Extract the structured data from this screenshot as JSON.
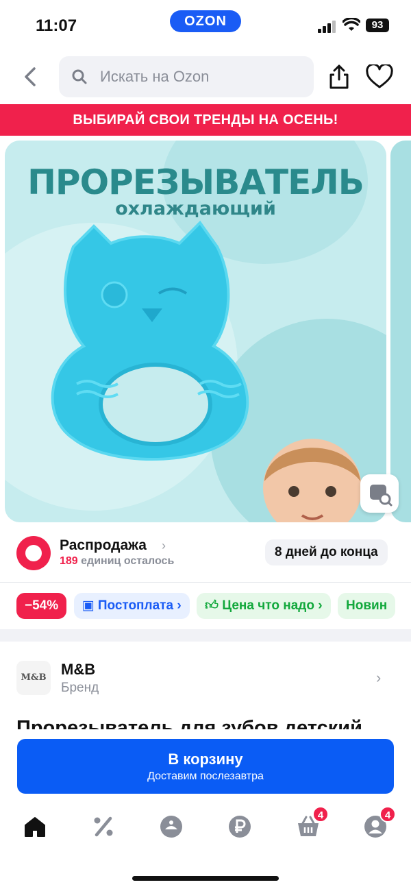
{
  "status_bar": {
    "time": "11:07",
    "carrier_logo": "OZON",
    "battery": "93"
  },
  "header": {
    "search_placeholder": "Искать на Ozon"
  },
  "promo_banner": {
    "text": "ВЫБИРАЙ СВОИ ТРЕНДЫ НА ОСЕНЬ!"
  },
  "product_image": {
    "title": "ПРОРЕЗЫВАТЕЛЬ",
    "subtitle": "охлаждающий"
  },
  "sale": {
    "title": "Распродажа",
    "count": "189",
    "count_suffix": "единиц осталось",
    "days_left": "8 дней до конца"
  },
  "chips": {
    "discount": "−54%",
    "postpay": "Постоплата",
    "price": "Цена что надо",
    "new": "Новин"
  },
  "brand": {
    "logo_text": "M&B",
    "name": "M&B",
    "label": "Бренд"
  },
  "product": {
    "title": "Прорезыватель для зубов детский"
  },
  "cart": {
    "label": "В корзину",
    "sub": "Доставим послезавтра"
  },
  "tabbar": {
    "cart_badge": "4",
    "profile_badge": "4"
  },
  "colors": {
    "brand_blue": "#0a5cf5",
    "accent_red": "#f0214c",
    "green": "#12a83c",
    "image_bg": "#c6ecee"
  }
}
